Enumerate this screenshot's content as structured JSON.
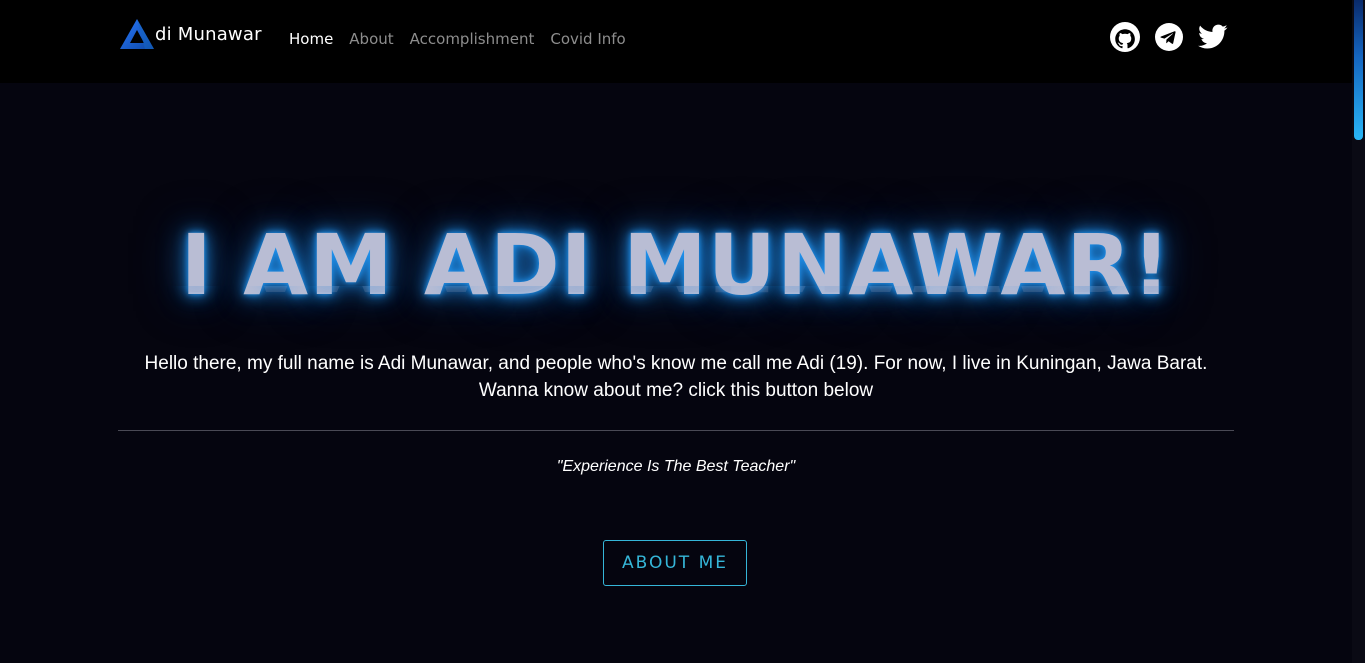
{
  "navbar": {
    "brand_text": "di Munawar",
    "brand_logo_icon": "triangle-a-logo-icon",
    "links": [
      {
        "label": "Home",
        "active": true
      },
      {
        "label": "About",
        "active": false
      },
      {
        "label": "Accomplishment",
        "active": false
      },
      {
        "label": "Covid Info",
        "active": false
      }
    ],
    "socials": [
      {
        "icon": "github-icon"
      },
      {
        "icon": "telegram-icon"
      },
      {
        "icon": "twitter-icon"
      }
    ]
  },
  "hero": {
    "title": "I AM ADI MUNAWAR!",
    "intro": "Hello there, my full name is Adi Munawar, and people who's know me call me Adi (19). For now, I live in Kuningan, Jawa Barat. Wanna know about me? click this button below",
    "quote": "\"Experience Is The Best Teacher\"",
    "button_label": "ABOUT ME"
  },
  "colors": {
    "background": "#05050f",
    "navbar": "#000000",
    "accent_glow": "#2196f3",
    "button_accent": "#35b6d8",
    "title_text": "#b9bdd4"
  }
}
